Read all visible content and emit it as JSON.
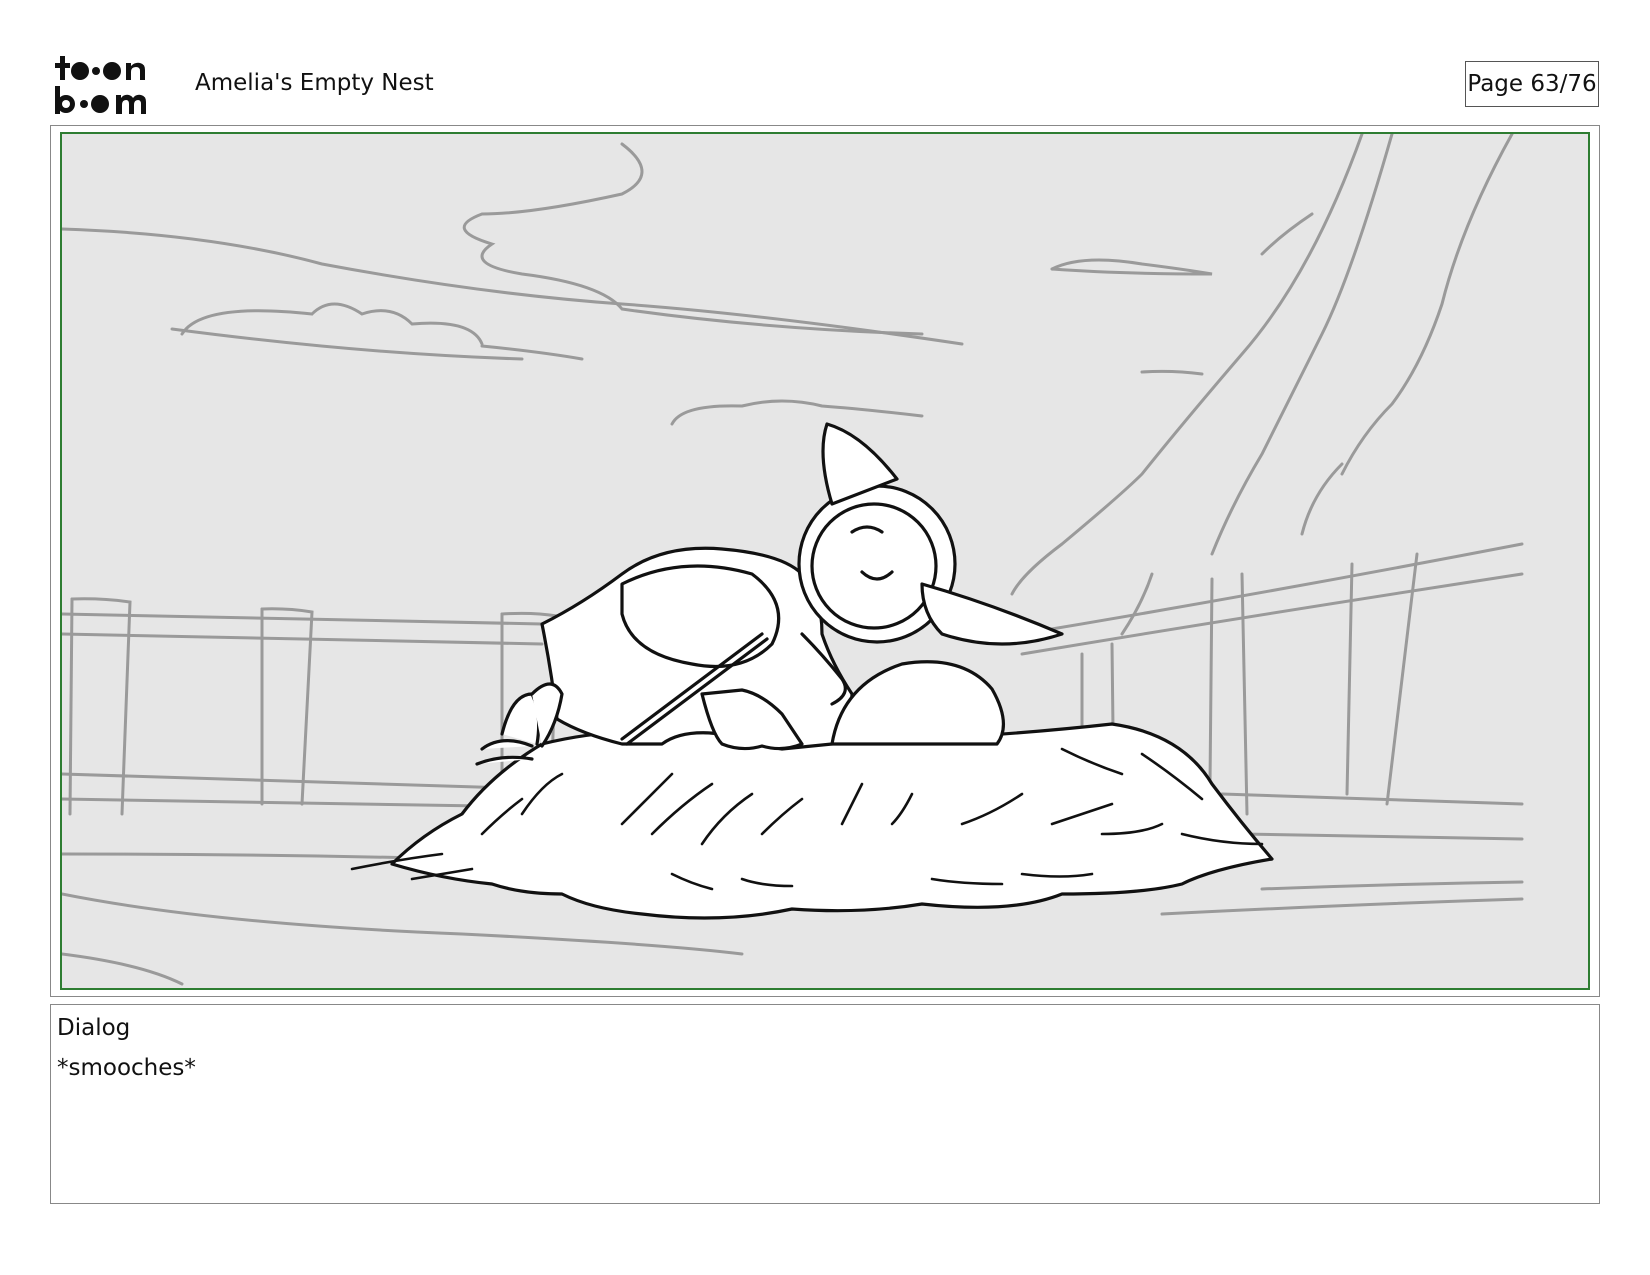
{
  "header": {
    "logo_line1": "to•n",
    "logo_line2": "b•om",
    "title": "Amelia's Empty Nest",
    "page": "Page 63/76"
  },
  "panel": {
    "frame_color": "#2e7d32",
    "background_color": "#e6e6e6",
    "image": "storyboard-sketch-bird-kissing-egg-in-nest"
  },
  "dialog": {
    "label": "Dialog",
    "text": "*smooches*"
  }
}
